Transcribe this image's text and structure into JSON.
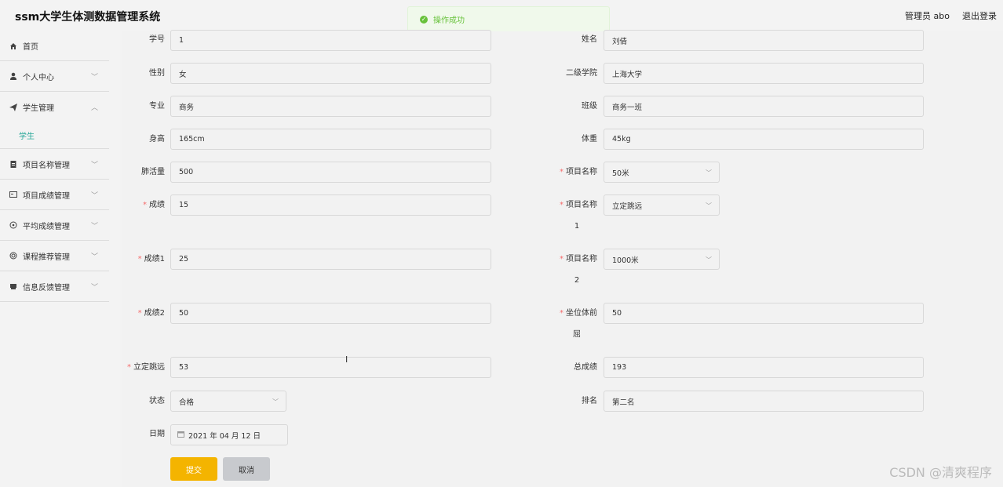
{
  "header": {
    "title": "ssm大学生体测数据管理系统",
    "user": "管理员 abo",
    "logout": "退出登录"
  },
  "toast": {
    "message": "操作成功"
  },
  "sidebar": {
    "items": [
      {
        "label": "首页",
        "icon": "home-icon"
      },
      {
        "label": "个人中心",
        "icon": "user-icon"
      },
      {
        "label": "学生管理",
        "icon": "send-icon"
      },
      {
        "label": "学生"
      },
      {
        "label": "项目名称管理",
        "icon": "clipboard-icon"
      },
      {
        "label": "项目成绩管理",
        "icon": "card-icon"
      },
      {
        "label": "平均成绩管理",
        "icon": "target-icon"
      },
      {
        "label": "课程推荐管理",
        "icon": "circle-icon"
      },
      {
        "label": "信息反馈管理",
        "icon": "folder-icon"
      }
    ]
  },
  "form": {
    "xuehao": {
      "label": "学号",
      "value": "1"
    },
    "xingming": {
      "label": "姓名",
      "value": "刘倩"
    },
    "xingbie": {
      "label": "性别",
      "value": "女"
    },
    "xueyuan": {
      "label": "二级学院",
      "value": "上海大学"
    },
    "zhuanye": {
      "label": "专业",
      "value": "商务"
    },
    "banji": {
      "label": "班级",
      "value": "商务一班"
    },
    "shengao": {
      "label": "身高",
      "value": "165cm"
    },
    "tizhong": {
      "label": "体重",
      "value": "45kg"
    },
    "feihuoliang": {
      "label": "肺活量",
      "value": "500"
    },
    "xiangmu": {
      "label": "项目名称",
      "value": "50米"
    },
    "chengji": {
      "label": "成绩",
      "value": "15"
    },
    "xiangmu1": {
      "label": "项目名称",
      "label2": "1",
      "value": "立定跳远"
    },
    "chengji1": {
      "label": "成绩1",
      "value": "25"
    },
    "xiangmu2": {
      "label": "项目名称",
      "label2": "2",
      "value": "1000米"
    },
    "chengji2": {
      "label": "成绩2",
      "value": "50"
    },
    "zuowei": {
      "label": "坐位体前",
      "label2": "屈",
      "value": "50"
    },
    "lidingtiaoyuan": {
      "label": "立定跳远",
      "value": "53"
    },
    "zongchengji": {
      "label": "总成绩",
      "value": "193"
    },
    "zhuangtai": {
      "label": "状态",
      "value": "合格"
    },
    "paiming": {
      "label": "排名",
      "value": "第二名"
    },
    "riqi": {
      "label": "日期",
      "value": "2021 年 04 月 12 日"
    },
    "submit": "提交",
    "cancel": "取消"
  },
  "watermark": "CSDN @清爽程序",
  "colors": {
    "accent": "#2aa89a",
    "submit": "#f4b400",
    "success": "#67c23a",
    "required": "#f56c6c"
  }
}
